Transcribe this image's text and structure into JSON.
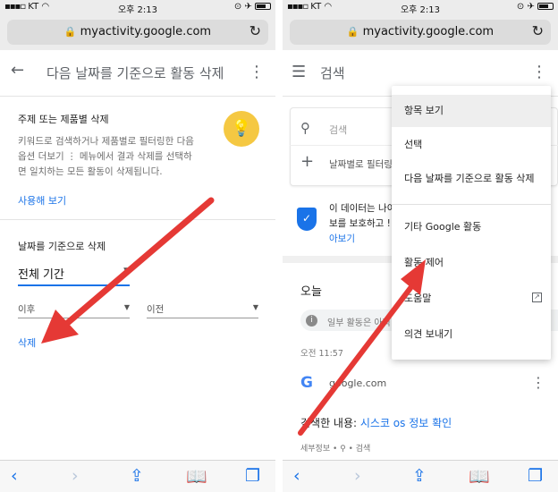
{
  "status": {
    "carrier": "KT",
    "time": "오후 2:13"
  },
  "browser": {
    "url": "myactivity.google.com"
  },
  "left": {
    "header_title": "다음 날짜를 기준으로 활동 삭제",
    "topic_section": {
      "title": "주제 또는 제품별 삭제",
      "desc_line1": "키워드로 검색하거나 제품별로 필터링한 다음",
      "desc_line2": "옵션 더보기 ⋮ 메뉴에서 결과 삭제를 선택하",
      "desc_line3": "면 일치하는 모든 활동이 삭제됩니다.",
      "try_link": "사용해 보기"
    },
    "date_section": {
      "title": "날짜를 기준으로 삭제",
      "range_value": "전체 기간",
      "after_label": "이후",
      "before_label": "이전",
      "delete_link": "삭제"
    }
  },
  "right": {
    "header_title": "검색",
    "search_placeholder": "검색",
    "filter_text": "날짜별로 필터링",
    "info_line1": "이 데이터는 나이",
    "info_line2": "보를 보호하고 !",
    "info_link": "아보기",
    "today_label": "오늘",
    "notice_text": "일부 활동은 아직",
    "time_label": "오전 11:57",
    "item_source": "google.com",
    "searched_prefix": "검색한 내용: ",
    "searched_query": "시스코 os 정보 확인",
    "meta_text": "세부정보 • ⚲ • 검색",
    "menu": {
      "items": [
        {
          "label": "항목 보기"
        },
        {
          "label": "선택"
        },
        {
          "label": "다음 날짜를 기준으로 활동 삭제"
        },
        {
          "label": "기타 Google 활동"
        },
        {
          "label": "활동 제어"
        },
        {
          "label": "도움말"
        },
        {
          "label": "의견 보내기"
        }
      ]
    }
  },
  "icons": {
    "back": "arrow-left-icon",
    "overflow": "kebab-icon",
    "menu": "hamburger-icon",
    "lock": "lock-icon",
    "reload": "reload-icon",
    "bulb": "lightbulb-icon",
    "search": "search-icon",
    "plus": "plus-icon",
    "shield": "shield-icon",
    "info": "info-icon",
    "external": "external-link-icon",
    "share": "share-icon",
    "bookmarks": "book-icon",
    "tabs": "tabs-icon"
  },
  "colors": {
    "accent": "#1a73e8",
    "annotation_arrow": "#e53935",
    "bulb": "#f5c842"
  }
}
